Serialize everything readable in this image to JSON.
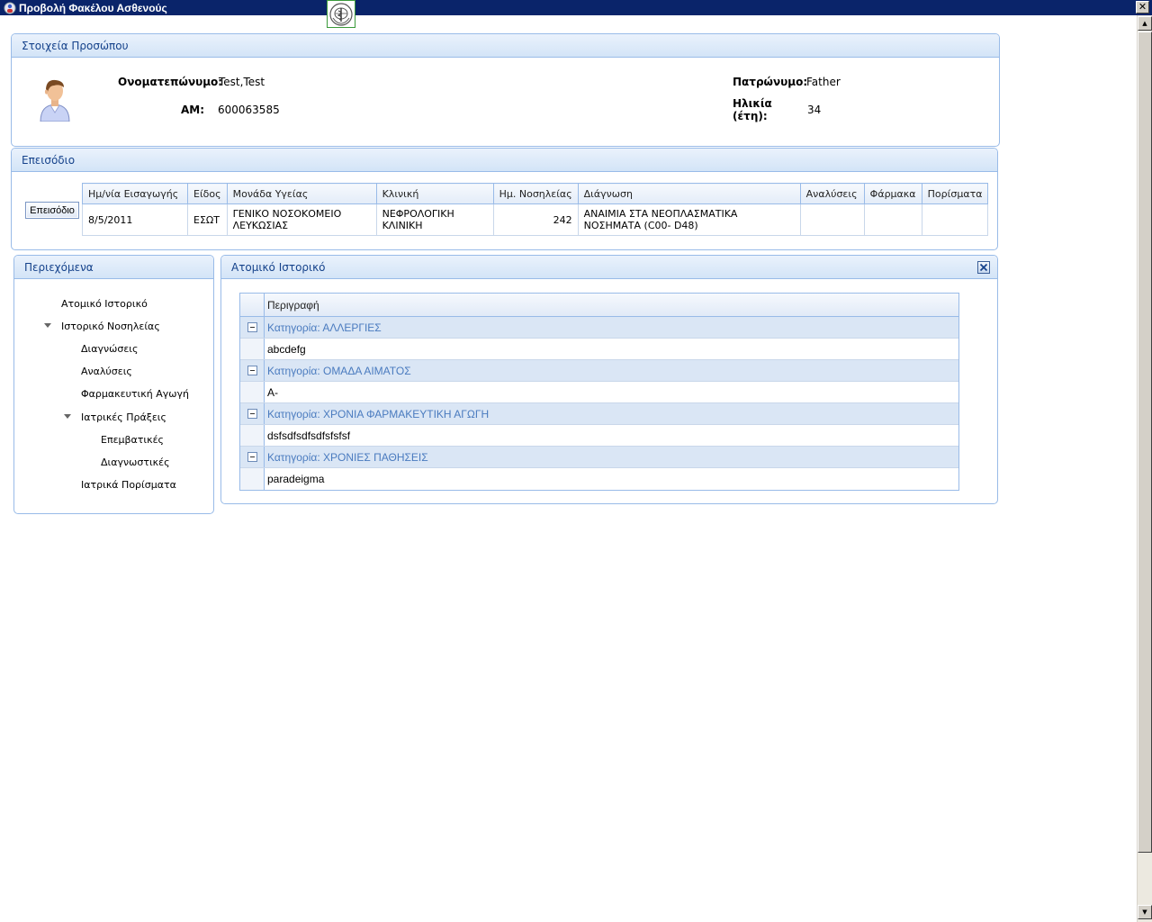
{
  "window": {
    "title": "Προβολή Φακέλου Ασθενούς",
    "close_symbol": "✕"
  },
  "person_panel": {
    "header": "Στοιχεία Προσώπου",
    "name_label": "Ονοματεπώνυμο:",
    "name_value": "Test,Test",
    "am_label": "ΑΜ:",
    "am_value": "600063585",
    "father_label": "Πατρώνυμο:",
    "father_value": "Father",
    "age_label_line1": "Ηλικία",
    "age_label_line2": "(έτη):",
    "age_value": "34"
  },
  "episode_panel": {
    "header": "Επεισόδιο",
    "button_label": "Επεισόδιο",
    "columns": [
      "Ημ/νία Εισαγωγής",
      "Είδος",
      "Μονάδα Υγείας",
      "Κλινική",
      "Ημ. Νοσηλείας",
      "Διάγνωση",
      "Αναλύσεις",
      "Φάρμακα",
      "Πορίσματα"
    ],
    "row": {
      "date": "8/5/2011",
      "type": "ΕΣΩΤ",
      "unit_line1": "ΓΕΝΙΚΟ ΝΟΣΟΚΟΜΕΙΟ",
      "unit_line2": "ΛΕΥΚΩΣΙΑΣ",
      "clinic_line1": "ΝΕΦΡΟΛΟΓΙΚΗ",
      "clinic_line2": "ΚΛΙΝΙΚΗ",
      "days": "242",
      "diagnosis_line1": "ΑΝΑΙΜΙΑ ΣΤΑ ΝΕΟΠΛΑΣΜΑΤΙΚΑ",
      "diagnosis_line2": "ΝΟΣΗΜΑΤΑ (C00- D48)",
      "analyses": "",
      "drugs": "",
      "findings": ""
    }
  },
  "contents_panel": {
    "header": "Περιεχόμενα",
    "items": [
      "Ατομικό Ιστορικό",
      "Ιστορικό Νοσηλείας",
      "Διαγνώσεις",
      "Αναλύσεις",
      "Φαρμακευτική Αγωγή",
      "Ιατρικές Πράξεις",
      "Επεμβατικές",
      "Διαγνωστικές",
      "Ιατρικά Πορίσματα"
    ]
  },
  "history_panel": {
    "header": "Ατομικό Ιστορικό",
    "close_symbol": "✕",
    "column": "Περιγραφή",
    "groups": [
      {
        "category": "Κατηγορία: ΑΛΛΕΡΓΙΕΣ",
        "value": "abcdefg"
      },
      {
        "category": "Κατηγορία: ΟΜΑΔΑ ΑΙΜΑΤΟΣ",
        "value": "A-"
      },
      {
        "category": "Κατηγορία: ΧΡΟΝΙΑ ΦΑΡΜΑΚΕΥΤΙΚΗ ΑΓΩΓΗ",
        "value": "dsfsdfsdfsdfsfsfsf"
      },
      {
        "category": "Κατηγορία: ΧΡΟΝΙΕΣ ΠΑΘΗΣΕΙΣ",
        "value": "paradeigma"
      }
    ]
  },
  "icons": {
    "app": "app-icon",
    "logo": "who-logo-icon",
    "avatar": "patient-avatar-icon",
    "expand": "collapse-minus-icon"
  },
  "colors": {
    "titlebar": "#0a246a",
    "panel_border": "#99bbe8",
    "header_text": "#15428b",
    "category_text": "#4a7bbf"
  }
}
